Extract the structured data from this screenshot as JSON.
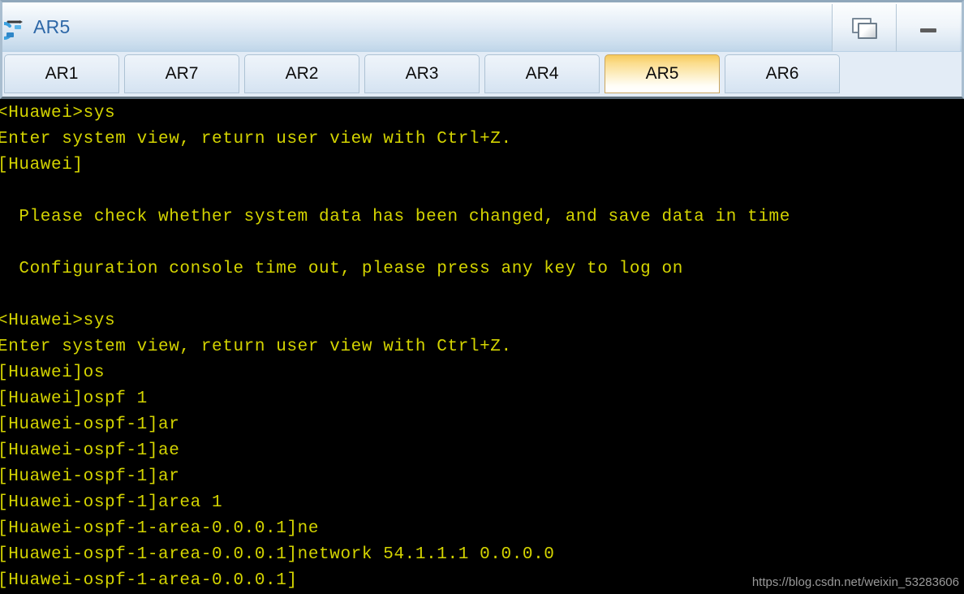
{
  "window": {
    "title": "AR5",
    "icon": "router-icon",
    "controls": [
      {
        "name": "restore-button",
        "label": "Restore"
      },
      {
        "name": "minimize-button",
        "label": "Minimize"
      }
    ]
  },
  "tabs": {
    "items": [
      {
        "label": "AR1",
        "active": false
      },
      {
        "label": "AR7",
        "active": false
      },
      {
        "label": "AR2",
        "active": false
      },
      {
        "label": "AR3",
        "active": false
      },
      {
        "label": "AR4",
        "active": false
      },
      {
        "label": "AR5",
        "active": true
      },
      {
        "label": "AR6",
        "active": false
      }
    ],
    "active_label": "AR5"
  },
  "terminal": {
    "foreground_color": "#d4d400",
    "background_color": "#000000",
    "lines": [
      "<Huawei>sys",
      "Enter system view, return user view with Ctrl+Z.",
      "[Huawei]",
      "",
      "  Please check whether system data has been changed, and save data in time",
      "",
      "  Configuration console time out, please press any key to log on",
      "",
      "<Huawei>sys",
      "Enter system view, return user view with Ctrl+Z.",
      "[Huawei]os",
      "[Huawei]ospf 1",
      "[Huawei-ospf-1]ar",
      "[Huawei-ospf-1]ae",
      "[Huawei-ospf-1]ar",
      "[Huawei-ospf-1]area 1",
      "[Huawei-ospf-1-area-0.0.0.1]ne",
      "[Huawei-ospf-1-area-0.0.0.1]network 54.1.1.1 0.0.0.0",
      "[Huawei-ospf-1-area-0.0.0.1]"
    ]
  },
  "watermark": {
    "text": "https://blog.csdn.net/weixin_53283606"
  }
}
